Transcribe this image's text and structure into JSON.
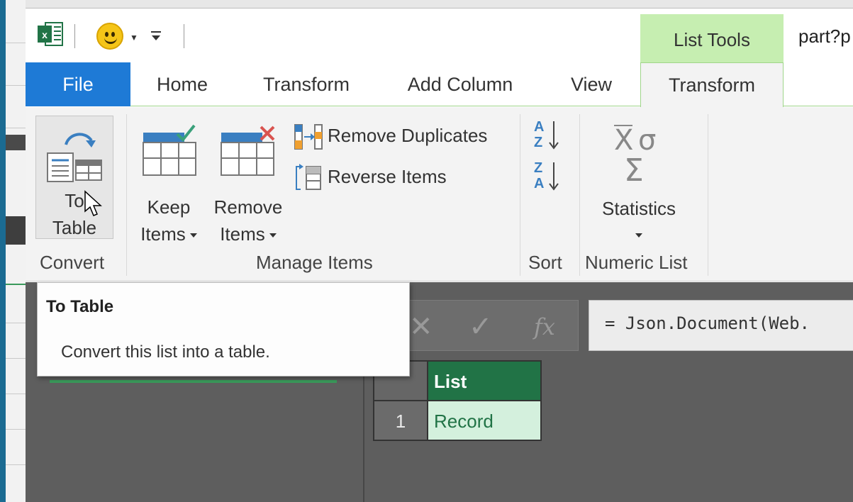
{
  "window": {
    "context_tab_group": "List Tools",
    "doc_title": "part?p"
  },
  "tabs": [
    {
      "label": "File"
    },
    {
      "label": "Home"
    },
    {
      "label": "Transform"
    },
    {
      "label": "Add Column"
    },
    {
      "label": "View"
    },
    {
      "label": "Transform",
      "active": true
    }
  ],
  "ribbon": {
    "convert": {
      "label": "Convert",
      "to_table_line1": "To",
      "to_table_line2": "Table"
    },
    "manage": {
      "label": "Manage Items",
      "keep_line1": "Keep",
      "keep_line2": "Items",
      "remove_line1": "Remove",
      "remove_line2": "Items",
      "remove_duplicates": "Remove Duplicates",
      "reverse_items": "Reverse Items"
    },
    "sort": {
      "label": "Sort"
    },
    "numeric": {
      "label": "Numeric List",
      "statistics": "Statistics"
    }
  },
  "tooltip": {
    "title": "To Table",
    "body": "Convert this list into a table."
  },
  "formula": {
    "text": "= Json.Document(Web.",
    "fx": "fx"
  },
  "grid": {
    "header": "List",
    "row_number": "1",
    "value": "Record"
  },
  "colors": {
    "file_tab": "#1e7ad6",
    "context_green": "#c6eeb1",
    "excel_green": "#217346",
    "cell_selected": "#d4f0dd"
  }
}
